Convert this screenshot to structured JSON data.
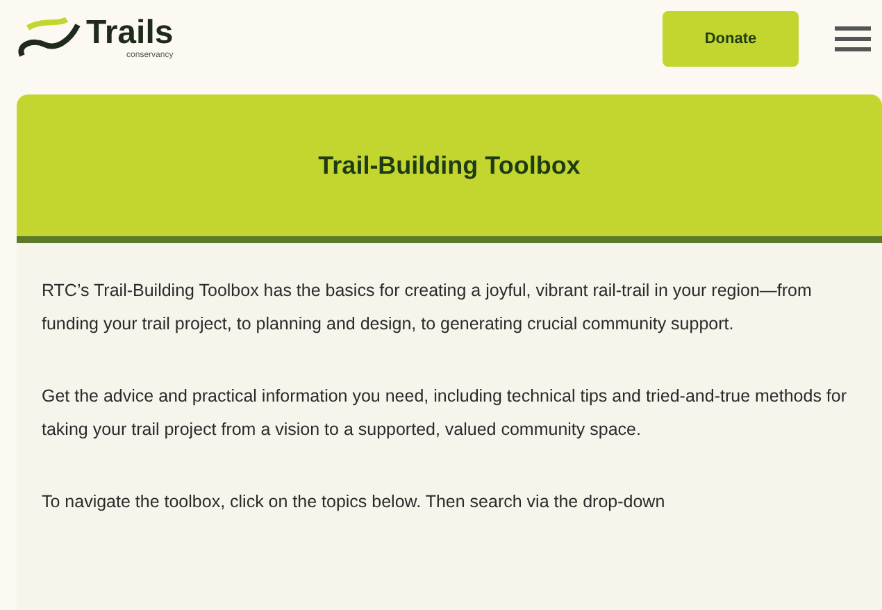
{
  "header": {
    "logo_text": "Trails",
    "logo_subtext": "conservancy",
    "donate_button": "Donate"
  },
  "banner": {
    "title": "Trail-Building Toolbox"
  },
  "paragraphs": [
    "RTC’s Trail-Building Toolbox has the basics for creating a joyful, vibrant rail-trail in your region—from funding your trail project, to planning and design, to generating crucial community support.",
    "Get the advice and practical information you need, including technical tips and tried-and-true methods for taking your trail project from a vision to a supported, valued community space.",
    "To navigate the toolbox, click on the topics below. Then search via the drop-down"
  ]
}
